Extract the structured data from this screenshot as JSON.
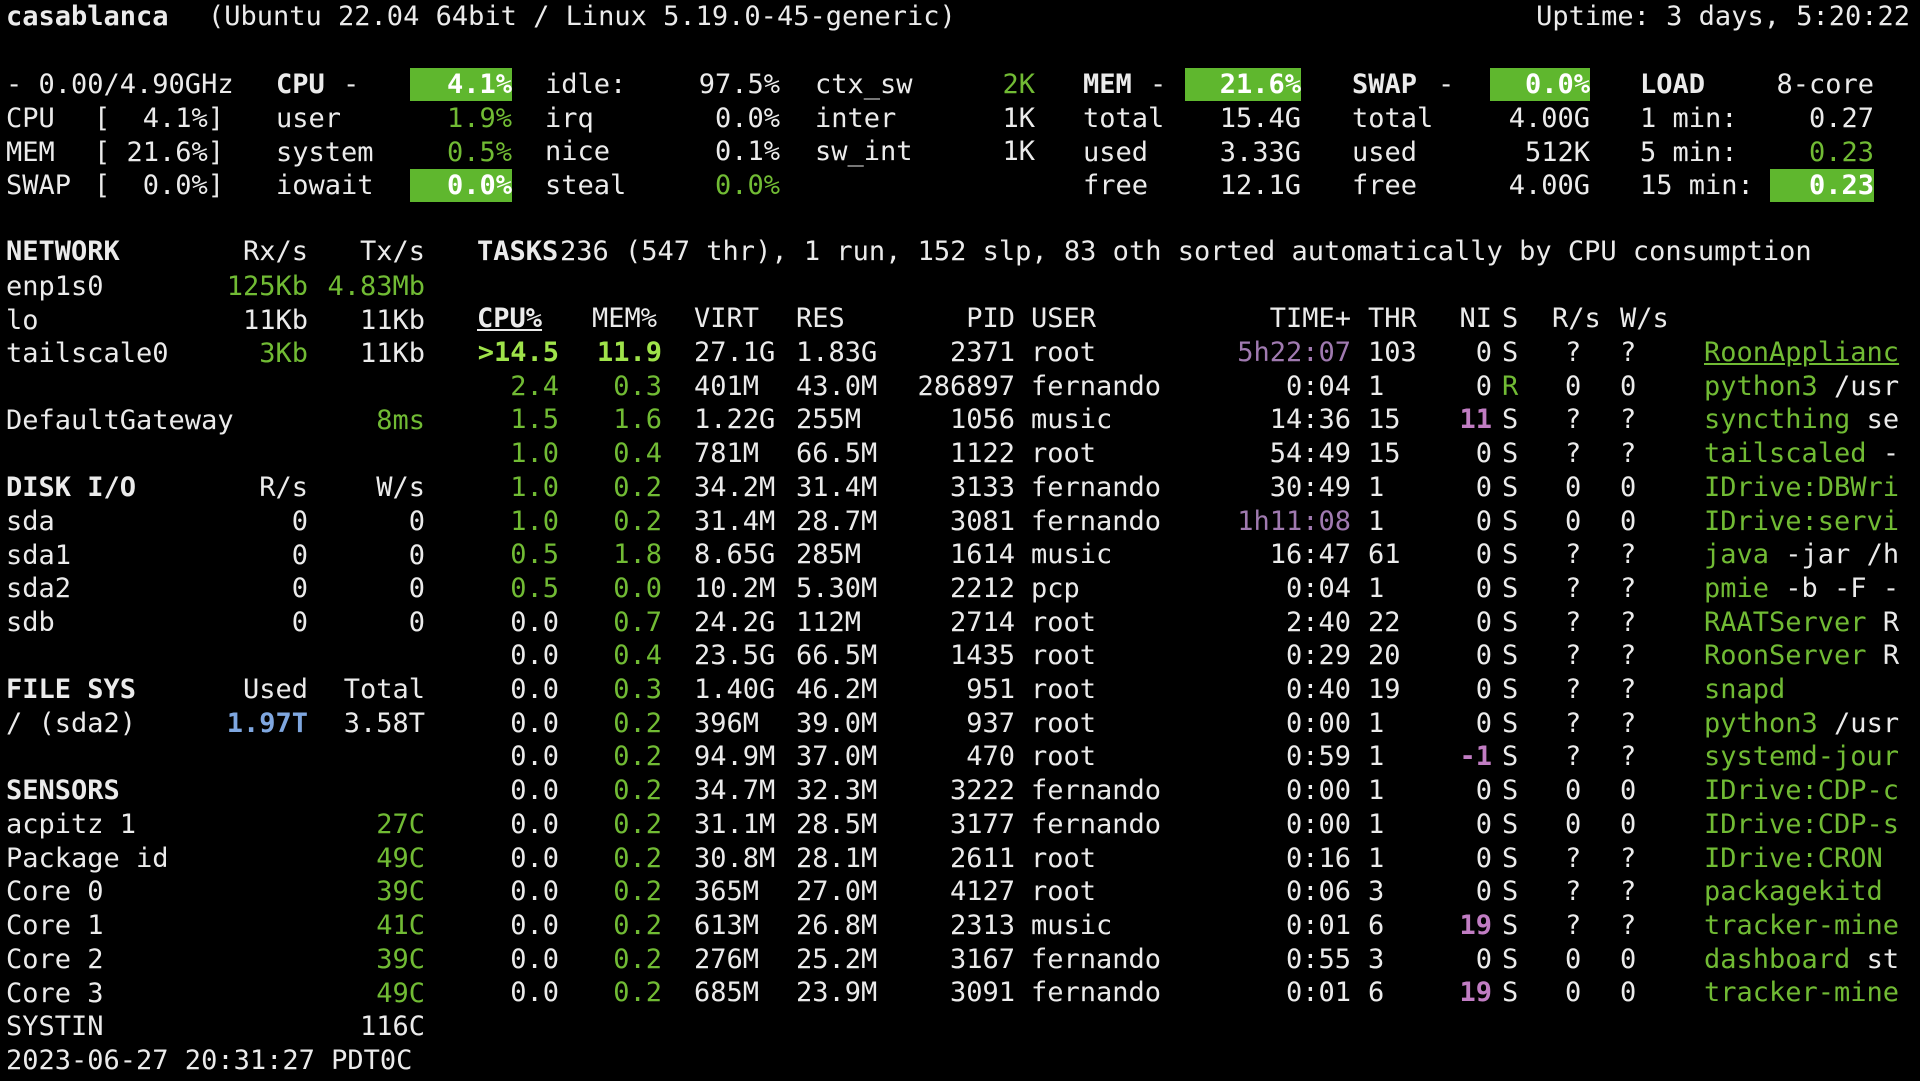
{
  "header": {
    "hostname": "casablanca",
    "system": "(Ubuntu 22.04 64bit / Linux 5.19.0-45-generic)",
    "uptime": "Uptime: 3 days, 5:20:22"
  },
  "quicklook": {
    "freq": "- 0.00/4.90GHz",
    "rows": [
      {
        "label": "CPU",
        "value": "[  4.1%]"
      },
      {
        "label": "MEM",
        "value": "[ 21.6%]"
      },
      {
        "label": "SWAP",
        "value": "[  0.0%]"
      }
    ]
  },
  "cpu": {
    "title": "CPU",
    "dash": "-",
    "total": "4.1%",
    "rows": [
      {
        "label": "user",
        "value": "1.9%"
      },
      {
        "label": "system",
        "value": "0.5%"
      },
      {
        "label": "iowait",
        "value": "0.0%"
      }
    ],
    "rows2": [
      {
        "label": "idle:",
        "value": "97.5%"
      },
      {
        "label": "irq",
        "value": "0.0%"
      },
      {
        "label": "nice",
        "value": "0.1%"
      },
      {
        "label": "steal",
        "value": "0.0%"
      }
    ],
    "rows3": [
      {
        "label": "ctx_sw",
        "value": "2K"
      },
      {
        "label": "inter",
        "value": "1K"
      },
      {
        "label": "sw_int",
        "value": "1K"
      }
    ]
  },
  "mem": {
    "title": "MEM",
    "dash": "-",
    "percent": "21.6%",
    "rows": [
      {
        "label": "total",
        "value": "15.4G"
      },
      {
        "label": "used",
        "value": "3.33G"
      },
      {
        "label": "free",
        "value": "12.1G"
      }
    ]
  },
  "swap": {
    "title": "SWAP",
    "dash": "-",
    "percent": "0.0%",
    "rows": [
      {
        "label": "total",
        "value": "4.00G"
      },
      {
        "label": "used",
        "value": "512K"
      },
      {
        "label": "free",
        "value": "4.00G"
      }
    ]
  },
  "load": {
    "title": "LOAD",
    "cores": "8-core",
    "rows": [
      {
        "label": "1 min:",
        "value": "0.27"
      },
      {
        "label": "5 min:",
        "value": "0.23"
      },
      {
        "label": "15 min:",
        "value": "0.23"
      }
    ]
  },
  "network": {
    "title": "NETWORK",
    "rx_header": "Rx/s",
    "tx_header": "Tx/s",
    "rows": [
      {
        "iface": "enp1s0",
        "rx": "125Kb",
        "tx": "4.83Mb"
      },
      {
        "iface": "lo",
        "rx": "11Kb",
        "tx": "11Kb"
      },
      {
        "iface": "tailscale0",
        "rx": "3Kb",
        "tx": "11Kb"
      }
    ],
    "gateway_label": "DefaultGateway",
    "gateway_value": "8ms"
  },
  "diskio": {
    "title": "DISK I/O",
    "r_header": "R/s",
    "w_header": "W/s",
    "rows": [
      {
        "disk": "sda",
        "r": "0",
        "w": "0"
      },
      {
        "disk": "sda1",
        "r": "0",
        "w": "0"
      },
      {
        "disk": "sda2",
        "r": "0",
        "w": "0"
      },
      {
        "disk": "sdb",
        "r": "0",
        "w": "0"
      }
    ]
  },
  "filesys": {
    "title": "FILE SYS",
    "used_header": "Used",
    "total_header": "Total",
    "rows": [
      {
        "mount": "/ (sda2)",
        "used": "1.97T",
        "total": "3.58T"
      }
    ]
  },
  "sensors": {
    "title": "SENSORS",
    "rows": [
      {
        "label": "acpitz 1",
        "value": "27C"
      },
      {
        "label": "Package id",
        "value": "49C"
      },
      {
        "label": "Core 0",
        "value": "39C"
      },
      {
        "label": "Core 1",
        "value": "41C"
      },
      {
        "label": "Core 2",
        "value": "39C"
      },
      {
        "label": "Core 3",
        "value": "49C"
      },
      {
        "label": "SYSTIN",
        "value": "116C"
      }
    ]
  },
  "footer": {
    "datetime": "2023-06-27 20:31:27 PDT0C"
  },
  "tasks": {
    "title": "TASKS",
    "summary": "236 (547 thr), 1 run, 152 slp, 83 oth sorted automatically by CPU consumption"
  },
  "processes": {
    "headers": {
      "cpu": "CPU%",
      "mem": "MEM%",
      "virt": "VIRT",
      "res": "RES",
      "pid": "PID",
      "user": "USER",
      "time": "TIME+",
      "thr": "THR",
      "ni": "NI",
      "s": "S",
      "rs": "R/s",
      "ws": "W/s"
    },
    "rows": [
      {
        "cpu": ">14.5",
        "mem": "11.9",
        "virt": "27.1G",
        "res": "1.83G",
        "pid": "2371",
        "user": "root",
        "time": "5h22:07",
        "thr": "103",
        "ni": "0",
        "s": "S",
        "rs": "?",
        "ws": "?",
        "cmd": "RoonApplianc",
        "args": ""
      },
      {
        "cpu": "2.4",
        "mem": "0.3",
        "virt": "401M",
        "res": "43.0M",
        "pid": "286897",
        "user": "fernando",
        "time": "0:04",
        "thr": "1",
        "ni": "0",
        "s": "R",
        "rs": "0",
        "ws": "0",
        "cmd": "python3",
        "args": " /usr"
      },
      {
        "cpu": "1.5",
        "mem": "1.6",
        "virt": "1.22G",
        "res": "255M",
        "pid": "1056",
        "user": "music",
        "time": "14:36",
        "thr": "15",
        "ni": "11",
        "s": "S",
        "rs": "?",
        "ws": "?",
        "cmd": "syncthing",
        "args": " se"
      },
      {
        "cpu": "1.0",
        "mem": "0.4",
        "virt": "781M",
        "res": "66.5M",
        "pid": "1122",
        "user": "root",
        "time": "54:49",
        "thr": "15",
        "ni": "0",
        "s": "S",
        "rs": "?",
        "ws": "?",
        "cmd": "tailscaled",
        "args": " -"
      },
      {
        "cpu": "1.0",
        "mem": "0.2",
        "virt": "34.2M",
        "res": "31.4M",
        "pid": "3133",
        "user": "fernando",
        "time": "30:49",
        "thr": "1",
        "ni": "0",
        "s": "S",
        "rs": "0",
        "ws": "0",
        "cmd": "IDrive:DBWri",
        "args": ""
      },
      {
        "cpu": "1.0",
        "mem": "0.2",
        "virt": "31.4M",
        "res": "28.7M",
        "pid": "3081",
        "user": "fernando",
        "time": "1h11:08",
        "thr": "1",
        "ni": "0",
        "s": "S",
        "rs": "0",
        "ws": "0",
        "cmd": "IDrive:servi",
        "args": ""
      },
      {
        "cpu": "0.5",
        "mem": "1.8",
        "virt": "8.65G",
        "res": "285M",
        "pid": "1614",
        "user": "music",
        "time": "16:47",
        "thr": "61",
        "ni": "0",
        "s": "S",
        "rs": "?",
        "ws": "?",
        "cmd": "java",
        "args": " -jar /h"
      },
      {
        "cpu": "0.5",
        "mem": "0.0",
        "virt": "10.2M",
        "res": "5.30M",
        "pid": "2212",
        "user": "pcp",
        "time": "0:04",
        "thr": "1",
        "ni": "0",
        "s": "S",
        "rs": "?",
        "ws": "?",
        "cmd": "pmie",
        "args": " -b -F -"
      },
      {
        "cpu": "0.0",
        "mem": "0.7",
        "virt": "24.2G",
        "res": "112M",
        "pid": "2714",
        "user": "root",
        "time": "2:40",
        "thr": "22",
        "ni": "0",
        "s": "S",
        "rs": "?",
        "ws": "?",
        "cmd": "RAATServer",
        "args": " R"
      },
      {
        "cpu": "0.0",
        "mem": "0.4",
        "virt": "23.5G",
        "res": "66.5M",
        "pid": "1435",
        "user": "root",
        "time": "0:29",
        "thr": "20",
        "ni": "0",
        "s": "S",
        "rs": "?",
        "ws": "?",
        "cmd": "RoonServer",
        "args": " R"
      },
      {
        "cpu": "0.0",
        "mem": "0.3",
        "virt": "1.40G",
        "res": "46.2M",
        "pid": "951",
        "user": "root",
        "time": "0:40",
        "thr": "19",
        "ni": "0",
        "s": "S",
        "rs": "?",
        "ws": "?",
        "cmd": "snapd",
        "args": ""
      },
      {
        "cpu": "0.0",
        "mem": "0.2",
        "virt": "396M",
        "res": "39.0M",
        "pid": "937",
        "user": "root",
        "time": "0:00",
        "thr": "1",
        "ni": "0",
        "s": "S",
        "rs": "?",
        "ws": "?",
        "cmd": "python3",
        "args": " /usr"
      },
      {
        "cpu": "0.0",
        "mem": "0.2",
        "virt": "94.9M",
        "res": "37.0M",
        "pid": "470",
        "user": "root",
        "time": "0:59",
        "thr": "1",
        "ni": "-1",
        "s": "S",
        "rs": "?",
        "ws": "?",
        "cmd": "systemd-jour",
        "args": ""
      },
      {
        "cpu": "0.0",
        "mem": "0.2",
        "virt": "34.7M",
        "res": "32.3M",
        "pid": "3222",
        "user": "fernando",
        "time": "0:00",
        "thr": "1",
        "ni": "0",
        "s": "S",
        "rs": "0",
        "ws": "0",
        "cmd": "IDrive:CDP-c",
        "args": ""
      },
      {
        "cpu": "0.0",
        "mem": "0.2",
        "virt": "31.1M",
        "res": "28.5M",
        "pid": "3177",
        "user": "fernando",
        "time": "0:00",
        "thr": "1",
        "ni": "0",
        "s": "S",
        "rs": "0",
        "ws": "0",
        "cmd": "IDrive:CDP-s",
        "args": ""
      },
      {
        "cpu": "0.0",
        "mem": "0.2",
        "virt": "30.8M",
        "res": "28.1M",
        "pid": "2611",
        "user": "root",
        "time": "0:16",
        "thr": "1",
        "ni": "0",
        "s": "S",
        "rs": "?",
        "ws": "?",
        "cmd": "IDrive:CRON",
        "args": ""
      },
      {
        "cpu": "0.0",
        "mem": "0.2",
        "virt": "365M",
        "res": "27.0M",
        "pid": "4127",
        "user": "root",
        "time": "0:06",
        "thr": "3",
        "ni": "0",
        "s": "S",
        "rs": "?",
        "ws": "?",
        "cmd": "packagekitd",
        "args": ""
      },
      {
        "cpu": "0.0",
        "mem": "0.2",
        "virt": "613M",
        "res": "26.8M",
        "pid": "2313",
        "user": "music",
        "time": "0:01",
        "thr": "6",
        "ni": "19",
        "s": "S",
        "rs": "?",
        "ws": "?",
        "cmd": "tracker-mine",
        "args": ""
      },
      {
        "cpu": "0.0",
        "mem": "0.2",
        "virt": "276M",
        "res": "25.2M",
        "pid": "3167",
        "user": "fernando",
        "time": "0:55",
        "thr": "3",
        "ni": "0",
        "s": "S",
        "rs": "0",
        "ws": "0",
        "cmd": "dashboard",
        "args": " st"
      },
      {
        "cpu": "0.0",
        "mem": "0.2",
        "virt": "685M",
        "res": "23.9M",
        "pid": "3091",
        "user": "fernando",
        "time": "0:01",
        "thr": "6",
        "ni": "19",
        "s": "S",
        "rs": "0",
        "ws": "0",
        "cmd": "tracker-mine",
        "args": ""
      }
    ]
  }
}
